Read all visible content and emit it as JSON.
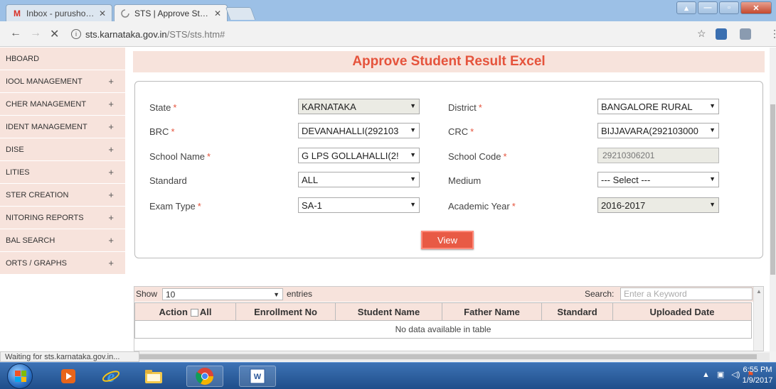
{
  "browser": {
    "tabs": [
      {
        "label": "Inbox - purushothamaku",
        "icon": "gmail-icon",
        "active": false
      },
      {
        "label": "STS | Approve Student Re",
        "icon": "loading-icon",
        "active": true
      }
    ],
    "url_host": "sts.karnataka.gov.in",
    "url_path": "/STS/sts.htm#",
    "status": "Waiting for sts.karnataka.gov.in..."
  },
  "sidebar": {
    "items": [
      {
        "label": "HBOARD",
        "plus": ""
      },
      {
        "label": "IOOL MANAGEMENT",
        "plus": "+"
      },
      {
        "label": "CHER MANAGEMENT",
        "plus": "+"
      },
      {
        "label": "IDENT MANAGEMENT",
        "plus": "+"
      },
      {
        "label": "DISE",
        "plus": "+"
      },
      {
        "label": "LITIES",
        "plus": "+"
      },
      {
        "label": "STER CREATION",
        "plus": "+"
      },
      {
        "label": "NITORING REPORTS",
        "plus": "+"
      },
      {
        "label": "BAL SEARCH",
        "plus": "+"
      },
      {
        "label": "ORTS / GRAPHS",
        "plus": "+"
      }
    ]
  },
  "page": {
    "title": "Approve Student Result Excel"
  },
  "form": {
    "state_label": "State",
    "state_value": "KARNATAKA",
    "district_label": "District",
    "district_value": "BANGALORE RURAL",
    "brc_label": "BRC",
    "brc_value": "DEVANAHALLI(292103",
    "crc_label": "CRC",
    "crc_value": "BIJJAVARA(292103000",
    "school_name_label": "School Name",
    "school_name_value": "G LPS GOLLAHALLI(2!",
    "school_code_label": "School Code",
    "school_code_value": "29210306201",
    "standard_label": "Standard",
    "standard_value": "ALL",
    "medium_label": "Medium",
    "medium_value": "--- Select ---",
    "exam_type_label": "Exam Type",
    "exam_type_value": "SA-1",
    "academic_year_label": "Academic Year",
    "academic_year_value": "2016-2017",
    "required_mark": "*",
    "view_label": "View"
  },
  "table": {
    "show_label": "Show",
    "length_value": "10",
    "entries_label": "entries",
    "search_label": "Search:",
    "search_placeholder": "Enter a Keyword",
    "columns": [
      "Action",
      "Enrollment No",
      "Student Name",
      "Father Name",
      "Standard",
      "Uploaded Date"
    ],
    "all_label": "All",
    "empty_message": "No data available in table"
  },
  "taskbar": {
    "time": "6:55 PM",
    "date": "1/9/2017"
  }
}
